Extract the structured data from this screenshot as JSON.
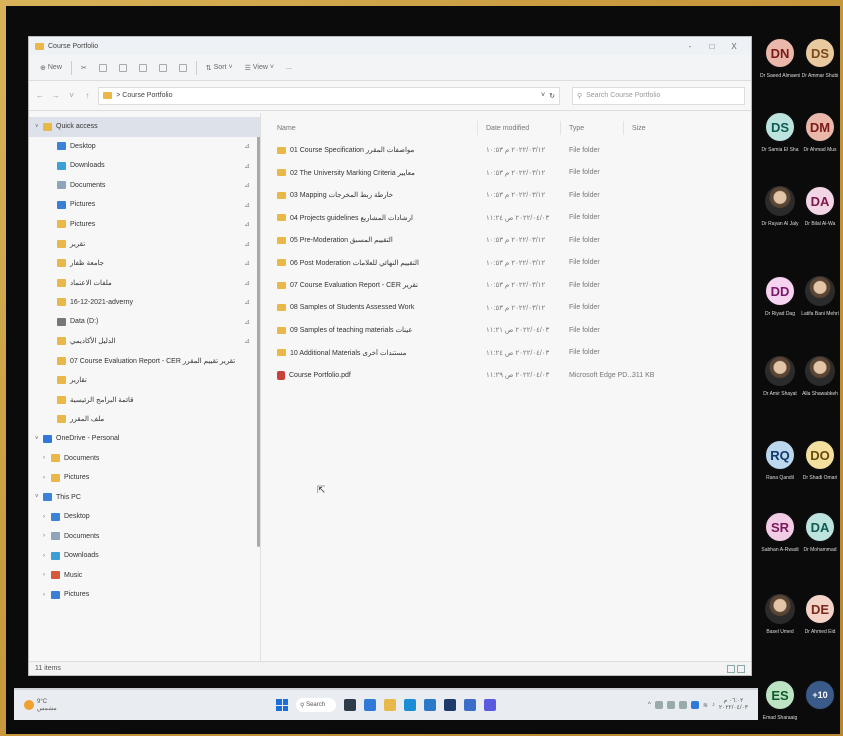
{
  "window": {
    "title": "Course Portfolio",
    "controls": {
      "minimize": "-",
      "maximize": "□",
      "close": "X"
    }
  },
  "ribbon": {
    "new": "New",
    "sort": "Sort",
    "view": "View",
    "more": "..."
  },
  "address": {
    "path": "> Course Portfolio",
    "search_placeholder": "Search Course Portfolio"
  },
  "nav": {
    "quick_access": "Quick access",
    "items": [
      {
        "label": "Desktop",
        "color": "#3a83d6",
        "pinned": true
      },
      {
        "label": "Downloads",
        "color": "#3aa0d6",
        "pinned": true
      },
      {
        "label": "Documents",
        "color": "#8fa4b8",
        "pinned": true
      },
      {
        "label": "Pictures",
        "color": "#3a7fd6",
        "pinned": true
      },
      {
        "label": "Pictures",
        "color": "#e8b84a",
        "pinned": true
      },
      {
        "label": "تقرير",
        "color": "#e8b84a",
        "pinned": true
      },
      {
        "label": "جامعة ظفار",
        "color": "#e8b84a",
        "pinned": true
      },
      {
        "label": "ملفات الاعتماد",
        "color": "#e8b84a",
        "pinned": true
      },
      {
        "label": "16-12-2021-adverny",
        "color": "#e8b84a",
        "pinned": true
      },
      {
        "label": "Data (D:)",
        "color": "#777777",
        "pinned": true
      },
      {
        "label": "الدليل الأكاديمي",
        "color": "#e8b84a",
        "pinned": true
      },
      {
        "label": "07 Course Evaluation Report - CER تقرير تقييم المقرر",
        "color": "#e8b84a",
        "pinned": false
      },
      {
        "label": "تقارير",
        "color": "#e8b84a",
        "pinned": false
      },
      {
        "label": "قائمة البرامج الرئيسية",
        "color": "#e8b84a",
        "pinned": false
      },
      {
        "label": "ملف المقرر",
        "color": "#e8b84a",
        "pinned": false
      }
    ],
    "onedrive": "OneDrive - Personal",
    "onedrive_items": [
      "Documents",
      "Pictures"
    ],
    "thispc": "This PC",
    "thispc_items": [
      {
        "label": "Desktop",
        "color": "#3a83d6"
      },
      {
        "label": "Documents",
        "color": "#8fa4b8"
      },
      {
        "label": "Downloads",
        "color": "#3aa0d6"
      },
      {
        "label": "Music",
        "color": "#d65a3a"
      },
      {
        "label": "Pictures",
        "color": "#3a7fd6"
      }
    ]
  },
  "columns": {
    "name": "Name",
    "date": "Date modified",
    "type": "Type",
    "size": "Size"
  },
  "files": [
    {
      "name": "01 Course Specification مواصفات المقرر",
      "date": "٢٠٢٢/٠٣/١٢ م ١٠:٥٣",
      "type": "File folder",
      "size": "",
      "kind": "folder"
    },
    {
      "name": "02 The University Marking Criteria معايير",
      "date": "٢٠٢٢/٠٣/١٢ م ١٠:٥٣",
      "type": "File folder",
      "size": "",
      "kind": "folder"
    },
    {
      "name": "03 Mapping خارطة ربط المخرجات",
      "date": "٢٠٢٢/٠٣/١٢ م ١٠:٥٣",
      "type": "File folder",
      "size": "",
      "kind": "folder"
    },
    {
      "name": "04 Projects guidelines ارشادات المشاريع",
      "date": "٢٠٢٢/٠٤/٠٣ ص ١١:٢٤",
      "type": "File folder",
      "size": "",
      "kind": "folder"
    },
    {
      "name": "05 Pre-Moderation التقييم المسبق",
      "date": "٢٠٢٢/٠٣/١٢ م ١٠:٥٣",
      "type": "File folder",
      "size": "",
      "kind": "folder"
    },
    {
      "name": "06 Post Moderation التقييم النهائي للعلامات",
      "date": "٢٠٢٢/٠٣/١٢ م ١٠:٥٣",
      "type": "File folder",
      "size": "",
      "kind": "folder"
    },
    {
      "name": "07 Course Evaluation Report - CER تقرير",
      "date": "٢٠٢٢/٠٣/١٢ م ١٠:٥٣",
      "type": "File folder",
      "size": "",
      "kind": "folder"
    },
    {
      "name": "08 Samples of Students Assessed Work",
      "date": "٢٠٢٢/٠٣/١٢ م ١٠:٥٣",
      "type": "File folder",
      "size": "",
      "kind": "folder"
    },
    {
      "name": "09 Samples of teaching materials عينات",
      "date": "٢٠٢٢/٠٤/٠٣ ص ١١:٢١",
      "type": "File folder",
      "size": "",
      "kind": "folder"
    },
    {
      "name": "10 Additional Materials مستندات أخرى",
      "date": "٢٠٢٢/٠٤/٠٣ ص ١١:٢٤",
      "type": "File folder",
      "size": "",
      "kind": "folder"
    },
    {
      "name": "Course Portfolio.pdf",
      "date": "٢٠٢٢/٠٤/٠٣ ص ١١:٢٩",
      "type": "Microsoft Edge PD...",
      "size": "311 KB",
      "kind": "pdf"
    }
  ],
  "status": {
    "count": "11 items"
  },
  "taskbar": {
    "weather_temp": "9°C",
    "weather_desc": "مشمس",
    "search": "Search",
    "time": "٠٦:٠٢ م",
    "date": "٢٠٢٢/٠٤/٠٣"
  },
  "participants": [
    {
      "initials": "DN",
      "name": "Dr Saeed Almaeni",
      "bg": "#e9b8aa",
      "fg": "#7a1a1a"
    },
    {
      "initials": "DS",
      "name": "Dr Ammar Shubi",
      "bg": "#e8c9a0",
      "fg": "#7a4a1a"
    },
    {
      "initials": "DS",
      "name": "Dr Samia El Sha",
      "bg": "#bde3de",
      "fg": "#0f5a52"
    },
    {
      "initials": "DM",
      "name": "Dr Ahmad Mus",
      "bg": "#e9b8aa",
      "fg": "#7a1a1a"
    },
    {
      "initials": "",
      "name": "Dr Rayan Al Jaly",
      "photo": true
    },
    {
      "initials": "DA",
      "name": "Dr Bilal Al-Wa",
      "bg": "#f2d6e6",
      "fg": "#7a1a4a"
    },
    {
      "initials": "DD",
      "name": "Dr Riyad Dag",
      "bg": "#f6d3f0",
      "fg": "#7a1a6a"
    },
    {
      "initials": "",
      "name": "Latifa Bani Mehri",
      "photo": true
    },
    {
      "initials": "",
      "name": "Dr Amir Shayat",
      "photo": true
    },
    {
      "initials": "",
      "name": "Alla Shawabkeh",
      "photo": true
    },
    {
      "initials": "RQ",
      "name": "Rana Qandil",
      "bg": "#bcd8ee",
      "fg": "#123a6a"
    },
    {
      "initials": "DO",
      "name": "Dr Shadi Omari",
      "bg": "#f3df9e",
      "fg": "#6a4a0a"
    },
    {
      "initials": "SR",
      "name": "Sabhan A-Rwadi",
      "bg": "#f2cbe4",
      "fg": "#7a1a5a"
    },
    {
      "initials": "DA",
      "name": "Dr Mohammad",
      "bg": "#bde3de",
      "fg": "#0f5a52"
    },
    {
      "initials": "",
      "name": "Basel Umed",
      "photo": true
    },
    {
      "initials": "DE",
      "name": "Dr Ahmed Eid",
      "bg": "#f4d3c9",
      "fg": "#7a2a1a"
    },
    {
      "initials": "ES",
      "name": "Emad Sharaaig",
      "bg": "#bde3c5",
      "fg": "#0f5a2a"
    },
    {
      "initials": "+10",
      "name": "",
      "bg": "#3a5a8a",
      "fg": "#ffffff",
      "small": true
    }
  ]
}
